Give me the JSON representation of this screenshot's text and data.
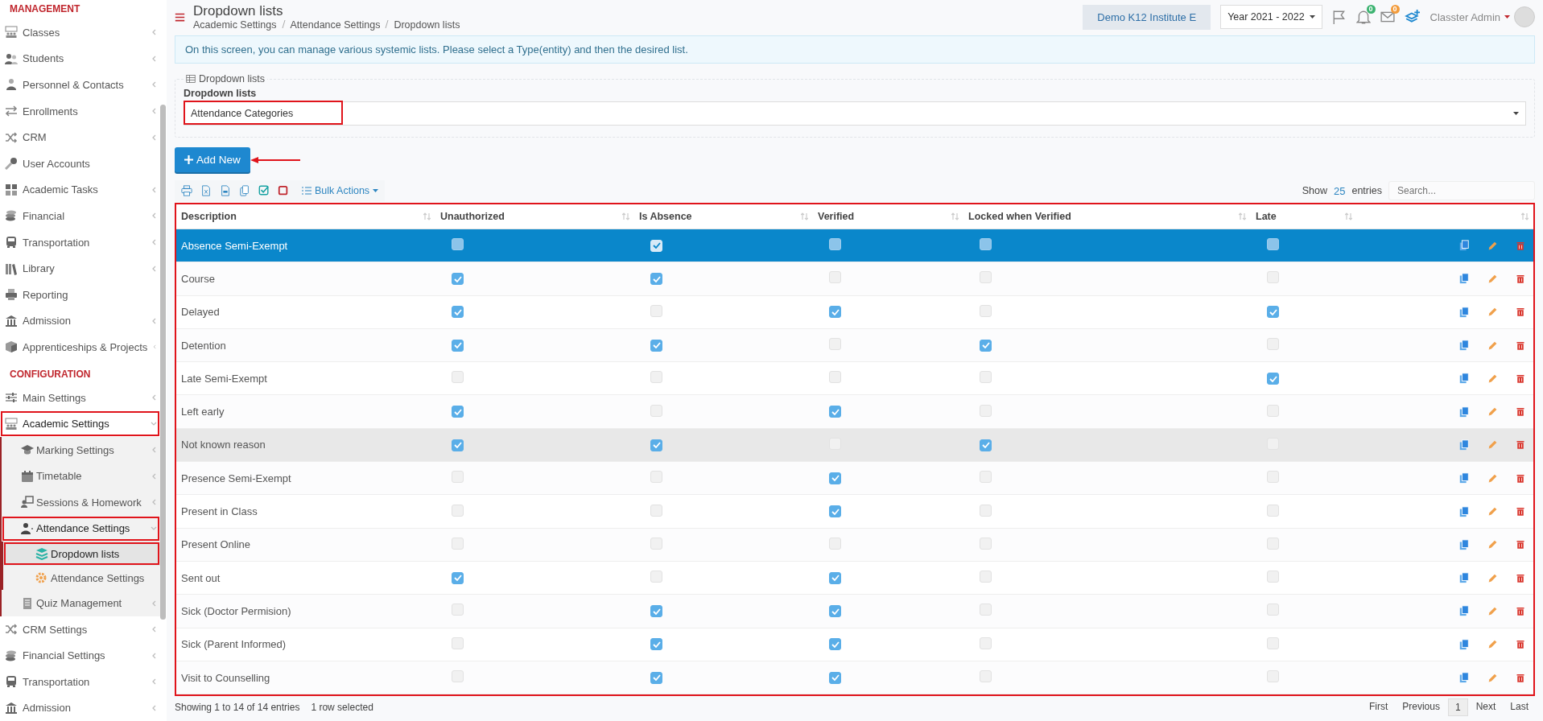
{
  "sidebar": {
    "sections": [
      {
        "title": "MANAGEMENT",
        "items": [
          {
            "label": "Classes",
            "expanded": false,
            "highlighted": false,
            "selected": false
          },
          {
            "label": "Students",
            "expanded": false,
            "highlighted": false,
            "selected": false
          },
          {
            "label": "Personnel & Contacts",
            "expanded": false,
            "highlighted": false,
            "selected": false
          },
          {
            "label": "Enrollments",
            "expanded": false,
            "highlighted": false,
            "selected": false
          },
          {
            "label": "CRM",
            "expanded": false,
            "highlighted": false,
            "selected": false
          },
          {
            "label": "User Accounts",
            "highlighted": false,
            "selected": false
          },
          {
            "label": "Academic Tasks",
            "expanded": false,
            "highlighted": false,
            "selected": false
          },
          {
            "label": "Financial",
            "expanded": false,
            "highlighted": false,
            "selected": false
          },
          {
            "label": "Transportation",
            "expanded": false,
            "highlighted": false,
            "selected": false
          },
          {
            "label": "Library",
            "expanded": false,
            "highlighted": false,
            "selected": false
          },
          {
            "label": "Reporting",
            "highlighted": false,
            "selected": false
          },
          {
            "label": "Admission",
            "expanded": false,
            "highlighted": false,
            "selected": false
          },
          {
            "label": "Apprenticeships & Projects",
            "expanded": false,
            "highlighted": false,
            "selected": false
          }
        ]
      },
      {
        "title": "CONFIGURATION",
        "items": [
          {
            "label": "Main Settings",
            "expanded": false,
            "highlighted": false,
            "selected": false
          },
          {
            "label": "Academic Settings",
            "expanded": true,
            "highlighted": true,
            "selected": false,
            "children": [
              {
                "label": "Marking Settings",
                "expanded": false,
                "highlighted": false,
                "selected": false
              },
              {
                "label": "Timetable",
                "expanded": false,
                "highlighted": false,
                "selected": false
              },
              {
                "label": "Sessions & Homework",
                "expanded": false,
                "highlighted": false,
                "selected": false
              },
              {
                "label": "Attendance Settings",
                "expanded": true,
                "highlighted": true,
                "selected": false,
                "children": [
                  {
                    "label": "Dropdown lists",
                    "highlighted": true,
                    "selected": true
                  },
                  {
                    "label": "Attendance Settings",
                    "highlighted": false,
                    "selected": false
                  }
                ]
              },
              {
                "label": "Quiz Management",
                "expanded": false,
                "highlighted": false,
                "selected": false
              }
            ]
          },
          {
            "label": "CRM Settings",
            "expanded": false,
            "highlighted": false,
            "selected": false
          },
          {
            "label": "Financial Settings",
            "expanded": false,
            "highlighted": false,
            "selected": false
          },
          {
            "label": "Transportation",
            "expanded": false,
            "highlighted": false,
            "selected": false
          },
          {
            "label": "Admission",
            "expanded": false,
            "highlighted": false,
            "selected": false
          }
        ]
      }
    ]
  },
  "header": {
    "title": "Dropdown lists",
    "breadcrumbs": [
      "Academic Settings",
      "Attendance Settings",
      "Dropdown lists"
    ],
    "institute": "Demo K12 Institute E",
    "year": "Year 2021 - 2022",
    "notifications": "0",
    "messages": "0",
    "user": "Classter Admin"
  },
  "info": "On this screen, you can manage various systemic lists. Please select a Type(entity) and then the desired list.",
  "panel": {
    "legend": "Dropdown lists",
    "label": "Dropdown lists",
    "value": "Attendance Categories",
    "highlighted": true
  },
  "add_button": {
    "label": "Add New",
    "annotation_arrow": true
  },
  "toolbar": {
    "bulk_actions": "Bulk Actions",
    "show": "Show",
    "page_size": "25",
    "entries": "entries",
    "search_placeholder": "Search..."
  },
  "table": {
    "highlighted": true,
    "columns": [
      "Description",
      "Unauthorized",
      "Is Absence",
      "Verified",
      "Locked when Verified",
      "Late"
    ],
    "rows": [
      {
        "description": "Absence Semi-Exempt",
        "checks": [
          false,
          true,
          false,
          false,
          false
        ],
        "selected": true,
        "hovered": false
      },
      {
        "description": "Course",
        "checks": [
          true,
          true,
          false,
          false,
          false
        ],
        "selected": false,
        "hovered": false
      },
      {
        "description": "Delayed",
        "checks": [
          true,
          false,
          true,
          false,
          true
        ],
        "selected": false,
        "hovered": false
      },
      {
        "description": "Detention",
        "checks": [
          true,
          true,
          false,
          true,
          false
        ],
        "selected": false,
        "hovered": false
      },
      {
        "description": "Late Semi-Exempt",
        "checks": [
          false,
          false,
          false,
          false,
          true
        ],
        "selected": false,
        "hovered": false
      },
      {
        "description": "Left early",
        "checks": [
          true,
          false,
          true,
          false,
          false
        ],
        "selected": false,
        "hovered": false
      },
      {
        "description": "Not known reason",
        "checks": [
          true,
          true,
          false,
          true,
          false
        ],
        "selected": false,
        "hovered": true
      },
      {
        "description": "Presence Semi-Exempt",
        "checks": [
          false,
          false,
          true,
          false,
          false
        ],
        "selected": false,
        "hovered": false
      },
      {
        "description": "Present in Class",
        "checks": [
          false,
          false,
          true,
          false,
          false
        ],
        "selected": false,
        "hovered": false
      },
      {
        "description": "Present Online",
        "checks": [
          false,
          false,
          false,
          false,
          false
        ],
        "selected": false,
        "hovered": false
      },
      {
        "description": "Sent out",
        "checks": [
          true,
          false,
          true,
          false,
          false
        ],
        "selected": false,
        "hovered": false
      },
      {
        "description": "Sick (Doctor Permision)",
        "checks": [
          false,
          true,
          true,
          false,
          false
        ],
        "selected": false,
        "hovered": false
      },
      {
        "description": "Sick (Parent Informed)",
        "checks": [
          false,
          true,
          true,
          false,
          false
        ],
        "selected": false,
        "hovered": false
      },
      {
        "description": "Visit to Counselling",
        "checks": [
          false,
          true,
          true,
          false,
          false
        ],
        "selected": false,
        "hovered": false
      }
    ],
    "info": "Showing 1 to 14 of 14 entries",
    "selection_info": "1 row selected"
  },
  "pagination": [
    {
      "label": "First",
      "selected": false
    },
    {
      "label": "Previous",
      "selected": false
    },
    {
      "label": "1",
      "selected": true
    },
    {
      "label": "Next",
      "selected": false
    },
    {
      "label": "Last",
      "selected": false
    }
  ]
}
